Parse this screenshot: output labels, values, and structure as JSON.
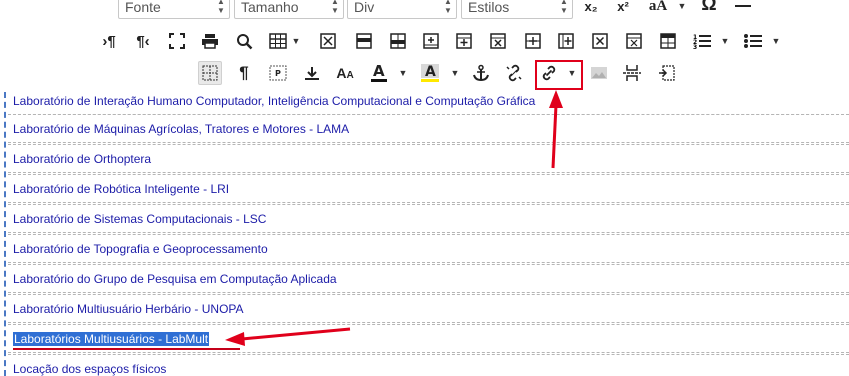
{
  "toolbar": {
    "font_select": "Fonte",
    "size_select": "Tamanho",
    "format_select": "Div",
    "styles_select": "Estilos",
    "subscript": "x₂",
    "superscript": "x²",
    "text_case": "aA",
    "special_char": "Ω"
  },
  "list": {
    "items": [
      "Laboratório de Interação Humano Computador, Inteligência Computacional e Computação Gráfica",
      "Laboratório de Máquinas Agrícolas, Tratores e Motores - LAMA",
      "Laboratório de Orthoptera",
      "Laboratório de Robótica Inteligente - LRI",
      "Laboratório de Sistemas Computacionais - LSC",
      "Laboratório de Topografia e Geoprocessamento",
      "Laboratório do Grupo de Pesquisa em Computação Aplicada",
      "Laboratório Multiusuário Herbário - UNOPA",
      "Laboratórios Multiusuários - LabMult",
      "Locação dos espaços físicos"
    ]
  },
  "colors": {
    "link": "#1c1ca8",
    "selection": "#2f6fd4",
    "annotation": "#e0001b"
  }
}
